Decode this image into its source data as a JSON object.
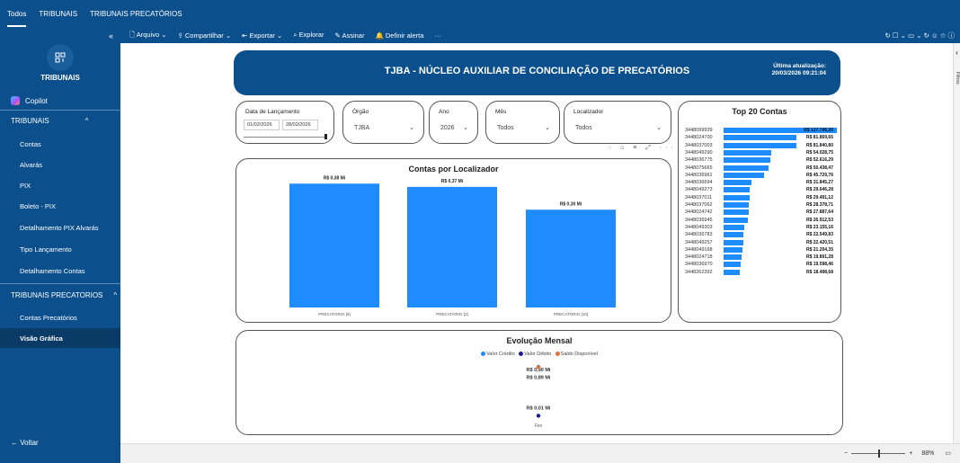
{
  "topnav": {
    "tabs": [
      "Todos",
      "TRIBUNAIS",
      "TRIBUNAIS PRECATÓRIOS"
    ]
  },
  "sidebar": {
    "collapse_icon": "«",
    "logo_icon": "grid-icon",
    "title": "TRIBUNAIS",
    "copilot": "Copilot",
    "section1": {
      "label": "TRIBUNAIS",
      "chevron": "^"
    },
    "items1": [
      "Contas",
      "Alvarás",
      "PIX",
      "Boleto - PIX",
      "Detalhamento PIX Alvarás",
      "Tipo Lançamento",
      "Detalhamento Contas"
    ],
    "section2": {
      "label": "TRIBUNAIS PRECATORIOS",
      "chevron": "^"
    },
    "items2": [
      "Contas Precatórios",
      "Visão Gráfica"
    ],
    "back": "← Voltar"
  },
  "toolbar": {
    "file": "🗋 Arquivo ⌄",
    "share": "⇪ Compartilhar ⌄",
    "export": "⇤ Exportar ⌄",
    "explore": "⌕ Explorar",
    "sign": "✎ Assinar",
    "alert": "🔔 Definir alerta",
    "more": "···",
    "right_icons": "↻  ☐ ⌄  ▭ ⌄  ↻  ☺  ☆  ⓘ"
  },
  "header": {
    "title": "TJBA - NÚCLEO AUXILIAR DE CONCILIAÇÃO DE PRECATÓRIOS",
    "update_label": "Última atualização:",
    "update_value": "20/03/2026 09:21:04"
  },
  "filters": {
    "date": {
      "label": "Data de Lançamento",
      "from": "01/02/2026",
      "to": "28/02/2026"
    },
    "orgao": {
      "label": "Órgão",
      "value": "TJBA"
    },
    "ano": {
      "label": "Ano",
      "value": "2026"
    },
    "mes": {
      "label": "Mês",
      "value": "Todos"
    },
    "localizador": {
      "label": "Localizador",
      "value": "Todos"
    }
  },
  "visual_icons": "◌ ⌂ ≡ ⤢ ···",
  "chart_data": [
    {
      "type": "bar",
      "title": "Contas por Localizador",
      "categories": [
        "PRECATORIO [8]",
        "PRECATORIO [3]",
        "PRECATORIO [10]"
      ],
      "values": [
        0.38,
        0.37,
        0.3
      ],
      "data_labels": [
        "R$ 0,38 Mi",
        "R$ 0,37 Mi",
        "R$ 0,30 Mi"
      ],
      "ylim": [
        0,
        0.4
      ],
      "color": "#1e8cff"
    },
    {
      "type": "bar",
      "title": "Top 20 Contas",
      "categories": [
        "3448099939",
        "3448024700",
        "3448037003",
        "3448049290",
        "3448036775",
        "3448075665",
        "3448036961",
        "3448036694",
        "3448049273",
        "3448037011",
        "3448037062",
        "3448024742",
        "3448036945",
        "3448049303",
        "3448036783",
        "3448049257",
        "3448049168",
        "3448024718",
        "3448036970",
        "3448262392"
      ],
      "values": [
        127746.3,
        81869.66,
        81840.8,
        54028.75,
        52616.29,
        50438.47,
        45729.76,
        31845.27,
        29646.28,
        29491.12,
        28378.71,
        27887.64,
        26912.53,
        23155.16,
        22549.83,
        22420.51,
        21204.35,
        19891.28,
        19598.46,
        18498.68
      ],
      "data_labels": [
        "R$ 127.746,30",
        "R$ 81.869,66",
        "R$ 81.840,80",
        "R$ 54.028,75",
        "R$ 52.616,29",
        "R$ 50.438,47",
        "R$ 45.729,76",
        "R$ 31.845,27",
        "R$ 29.646,28",
        "R$ 29.491,12",
        "R$ 28.378,71",
        "R$ 27.887,64",
        "R$ 26.912,53",
        "R$ 23.155,16",
        "R$ 22.549,83",
        "R$ 22.420,51",
        "R$ 21.204,35",
        "R$ 19.891,28",
        "R$ 19.598,46",
        "R$ 18.498,68"
      ],
      "orientation": "horizontal",
      "color": "#1e8cff"
    },
    {
      "type": "line",
      "title": "Evolução Mensal",
      "x": [
        "Fev"
      ],
      "legend_position": "top-center",
      "series": [
        {
          "name": "Valor Crédito",
          "values": [
            0.9
          ],
          "label": "R$ 0,90 Mi",
          "color": "#1e8cff"
        },
        {
          "name": "Valor Débito",
          "values": [
            0.01
          ],
          "label": "R$ 0,01 Mi",
          "color": "#1a1aa0"
        },
        {
          "name": "Saldo Disponível",
          "values": [
            0.89
          ],
          "label": "R$ 0,89 Mi",
          "color": "#e8703a"
        }
      ]
    }
  ],
  "status": {
    "zoom": "88%",
    "minus": "−",
    "plus": "+",
    "fit_icon": "▭"
  },
  "right_pane": {
    "label": "Filtros",
    "arrow": "‹"
  }
}
